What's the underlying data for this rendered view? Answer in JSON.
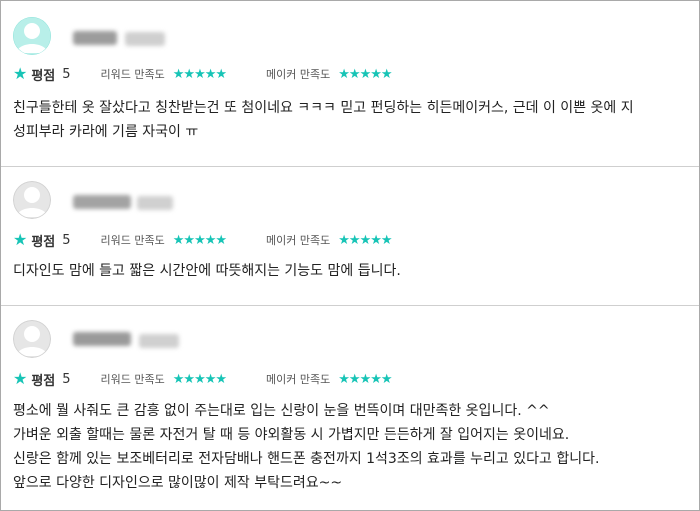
{
  "reviews": [
    {
      "avatar": "avatar-teal-icon",
      "score_label": "평점",
      "score": "5",
      "label1": "리워드 만족도",
      "label2": "메이커 만족도",
      "stars": "★★★★★",
      "lines": [
        "친구들한테 옷 잘샀다고 칭찬받는건 또 첨이네요 ㅋㅋㅋ 믿고 펀딩하는 히든메이커스, 근데 이 이쁜 옷에 지",
        "성피부라 카라에 기름 자국이 ㅠ"
      ]
    },
    {
      "avatar": "avatar-gray-icon",
      "score_label": "평점",
      "score": "5",
      "label1": "리워드 만족도",
      "label2": "메이커 만족도",
      "stars": "★★★★★",
      "lines": [
        "디자인도 맘에 들고 짧은 시간안에 따뜻해지는 기능도 맘에 듭니다."
      ]
    },
    {
      "avatar": "avatar-gray-icon",
      "score_label": "평점",
      "score": "5",
      "label1": "리워드 만족도",
      "label2": "메이커 만족도",
      "stars": "★★★★★",
      "lines": [
        "평소에 뭘 사줘도 큰 감흥 없이 주는대로 입는 신랑이 눈을 번뜩이며 대만족한 옷입니다. ^^",
        "가벼운 외출 할때는 물론 자전거 탈 때 등 야외활동 시 가볍지만 든든하게 잘 입어지는 옷이네요.",
        "신랑은 함께 있는 보조베터리로 전자담배나 핸드폰 충전까지 1석3조의 효과를 누리고 있다고 합니다.",
        "앞으로 다양한 디자인으로 많이많이 제작 부탁드려요~~"
      ]
    }
  ],
  "colors": {
    "accent": "#17c4b6",
    "avatar_teal": "#7ee0d8",
    "avatar_gray": "#d9d9d9"
  }
}
